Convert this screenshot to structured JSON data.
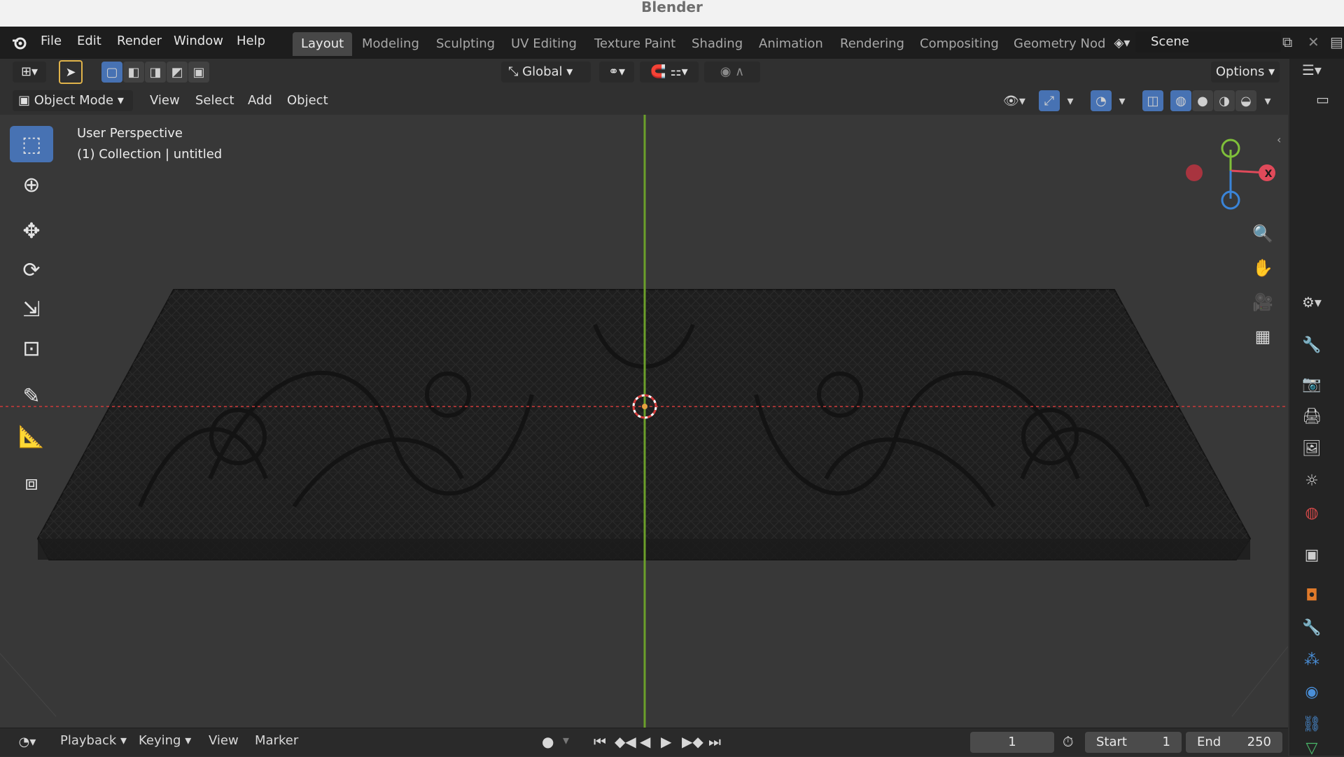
{
  "window": {
    "title": "Blender"
  },
  "menus": [
    "File",
    "Edit",
    "Render",
    "Window",
    "Help"
  ],
  "workspaces": [
    "Layout",
    "Modeling",
    "Sculpting",
    "UV Editing",
    "Texture Paint",
    "Shading",
    "Animation",
    "Rendering",
    "Compositing",
    "Geometry Nod"
  ],
  "active_workspace": "Layout",
  "scene": {
    "name": "Scene"
  },
  "tool_header": {
    "orientation": "Global",
    "options_label": "Options"
  },
  "view_header": {
    "mode": "Object Mode",
    "menus": [
      "View",
      "Select",
      "Add",
      "Object"
    ]
  },
  "viewport": {
    "perspective_label": "User Perspective",
    "collection_label": "(1) Collection | untitled",
    "gizmo": {
      "x_label": "X",
      "x_color": "#e04a5a",
      "y_color": "#7fbf3a",
      "z_color": "#3a84d8"
    }
  },
  "toolbar_icons": [
    "select-box-icon",
    "cursor-icon",
    "move-icon",
    "rotate-icon",
    "scale-icon",
    "transform-icon",
    "annotate-icon",
    "measure-icon",
    "add-cube-icon"
  ],
  "timeline": {
    "menus": [
      "Playback",
      "Keying",
      "View",
      "Marker"
    ],
    "current_frame": "1",
    "start_label": "Start",
    "start_value": "1",
    "end_label": "End",
    "end_value": "250"
  },
  "colors": {
    "accent": "#4772b3",
    "background": "#383838",
    "header": "#303030",
    "x_axis": "#c53a3a",
    "y_axis": "#6b9f2a"
  }
}
